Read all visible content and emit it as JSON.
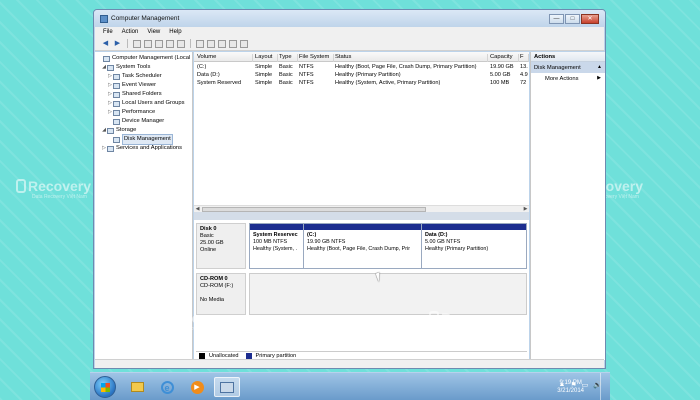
{
  "window": {
    "title": "Computer Management",
    "btn_minimize": "—",
    "btn_maximize": "□",
    "btn_close": "✕"
  },
  "menu": [
    "File",
    "Action",
    "View",
    "Help"
  ],
  "tree": [
    {
      "label": "Computer Management (Local",
      "level": 0,
      "exp": ""
    },
    {
      "label": "System Tools",
      "level": 1,
      "exp": "◢"
    },
    {
      "label": "Task Scheduler",
      "level": 2,
      "exp": "▷"
    },
    {
      "label": "Event Viewer",
      "level": 2,
      "exp": "▷"
    },
    {
      "label": "Shared Folders",
      "level": 2,
      "exp": "▷"
    },
    {
      "label": "Local Users and Groups",
      "level": 2,
      "exp": "▷"
    },
    {
      "label": "Performance",
      "level": 2,
      "exp": "▷"
    },
    {
      "label": "Device Manager",
      "level": 2,
      "exp": ""
    },
    {
      "label": "Storage",
      "level": 1,
      "exp": "◢"
    },
    {
      "label": "Disk Management",
      "level": 2,
      "exp": ""
    },
    {
      "label": "Services and Applications",
      "level": 1,
      "exp": "▷"
    }
  ],
  "volume_table": {
    "headers": [
      "Volume",
      "Layout",
      "Type",
      "File System",
      "Status",
      "Capacity",
      "F"
    ],
    "rows": [
      [
        "(C:)",
        "Simple",
        "Basic",
        "NTFS",
        "Healthy (Boot, Page File, Crash Dump, Primary Partition)",
        "19.90 GB",
        "13."
      ],
      [
        "Data (D:)",
        "Simple",
        "Basic",
        "NTFS",
        "Healthy (Primary Partition)",
        "5.00 GB",
        "4.9"
      ],
      [
        "System Reserved",
        "Simple",
        "Basic",
        "NTFS",
        "Healthy (System, Active, Primary Partition)",
        "100 MB",
        "72"
      ]
    ]
  },
  "disks": [
    {
      "name": "Disk 0",
      "type": "Basic",
      "size": "25.00 GB",
      "state": "Online",
      "partitions": [
        {
          "name": "System Reservec",
          "size": "100 MB NTFS",
          "status": "Healthy (System, ."
        },
        {
          "name": "(C:)",
          "size": "19.90 GB NTFS",
          "status": "Healthy (Boot, Page File, Crash Dump, Prir"
        },
        {
          "name": "Data (D:)",
          "size": "5.00 GB NTFS",
          "status": "Healthy (Primary Partition)"
        }
      ]
    },
    {
      "name": "CD-ROM 0",
      "type": "CD-ROM (F:)",
      "media": "No Media"
    }
  ],
  "legend": [
    {
      "label": "Unallocated",
      "color": "#000000"
    },
    {
      "label": "Primary partition",
      "color": "#1c2d8f"
    }
  ],
  "actions": {
    "header": "Actions",
    "section": "Disk Management",
    "section_caret": "▲",
    "more": "More Actions",
    "more_arrow": "▶"
  },
  "watermark": {
    "brand": "Recovery",
    "tagline": "Data Recovery Việt Nam"
  },
  "taskbar": {
    "time": "9:19 PM",
    "date": "3/21/2014",
    "tray_icons": [
      "▲",
      "⚑",
      "▭",
      "🔊"
    ]
  }
}
